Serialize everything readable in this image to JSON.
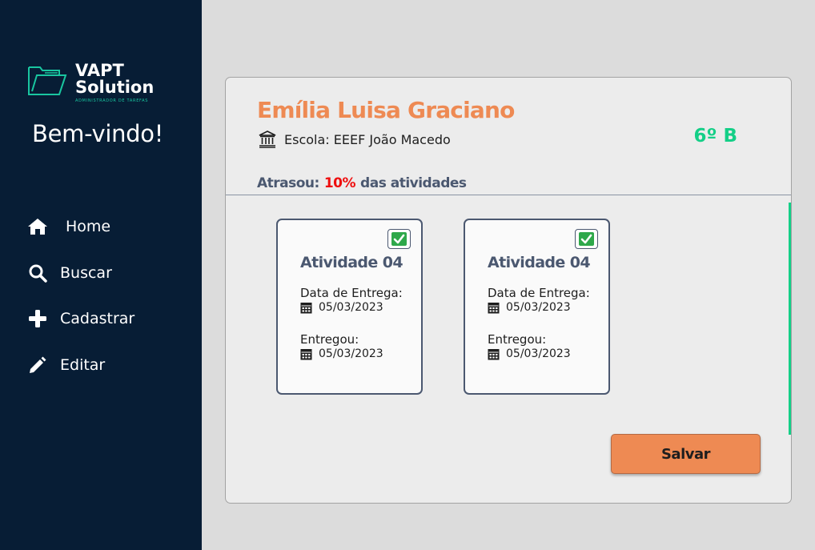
{
  "sidebar": {
    "logo": {
      "line1": "VAPT",
      "line2": "Solution",
      "tagline": "ADMINISTRADOR DE TAREFAS"
    },
    "welcome": "Bem-vindo!",
    "items": [
      {
        "label": "Home",
        "icon": "home-icon"
      },
      {
        "label": "Buscar",
        "icon": "search-icon"
      },
      {
        "label": "Cadastrar",
        "icon": "plus-icon"
      },
      {
        "label": "Editar",
        "icon": "pencil-icon"
      }
    ]
  },
  "student": {
    "name": "Emília Luisa Graciano",
    "school": "Escola: EEEF João Macedo",
    "class": "6º B",
    "late_prefix": "Atrasou:",
    "late_percent": "10%",
    "late_suffix": "das atividades"
  },
  "activities": [
    {
      "title": "Atividade 04",
      "checked": true,
      "due_label": "Data de Entrega:",
      "due_date": "05/03/2023",
      "delivered_label": "Entregou:",
      "delivered_date": "05/03/2023"
    },
    {
      "title": "Atividade 04",
      "checked": true,
      "due_label": "Data de Entrega:",
      "due_date": "05/03/2023",
      "delivered_label": "Entregou:",
      "delivered_date": "05/03/2023"
    }
  ],
  "actions": {
    "save_label": "Salvar"
  },
  "colors": {
    "sidebar_bg": "#071d35",
    "accent_orange": "#ee8a53",
    "accent_green": "#14cf87",
    "late_red": "#ef0e0e",
    "slate": "#4b5870",
    "check_green": "#2ea84a"
  }
}
